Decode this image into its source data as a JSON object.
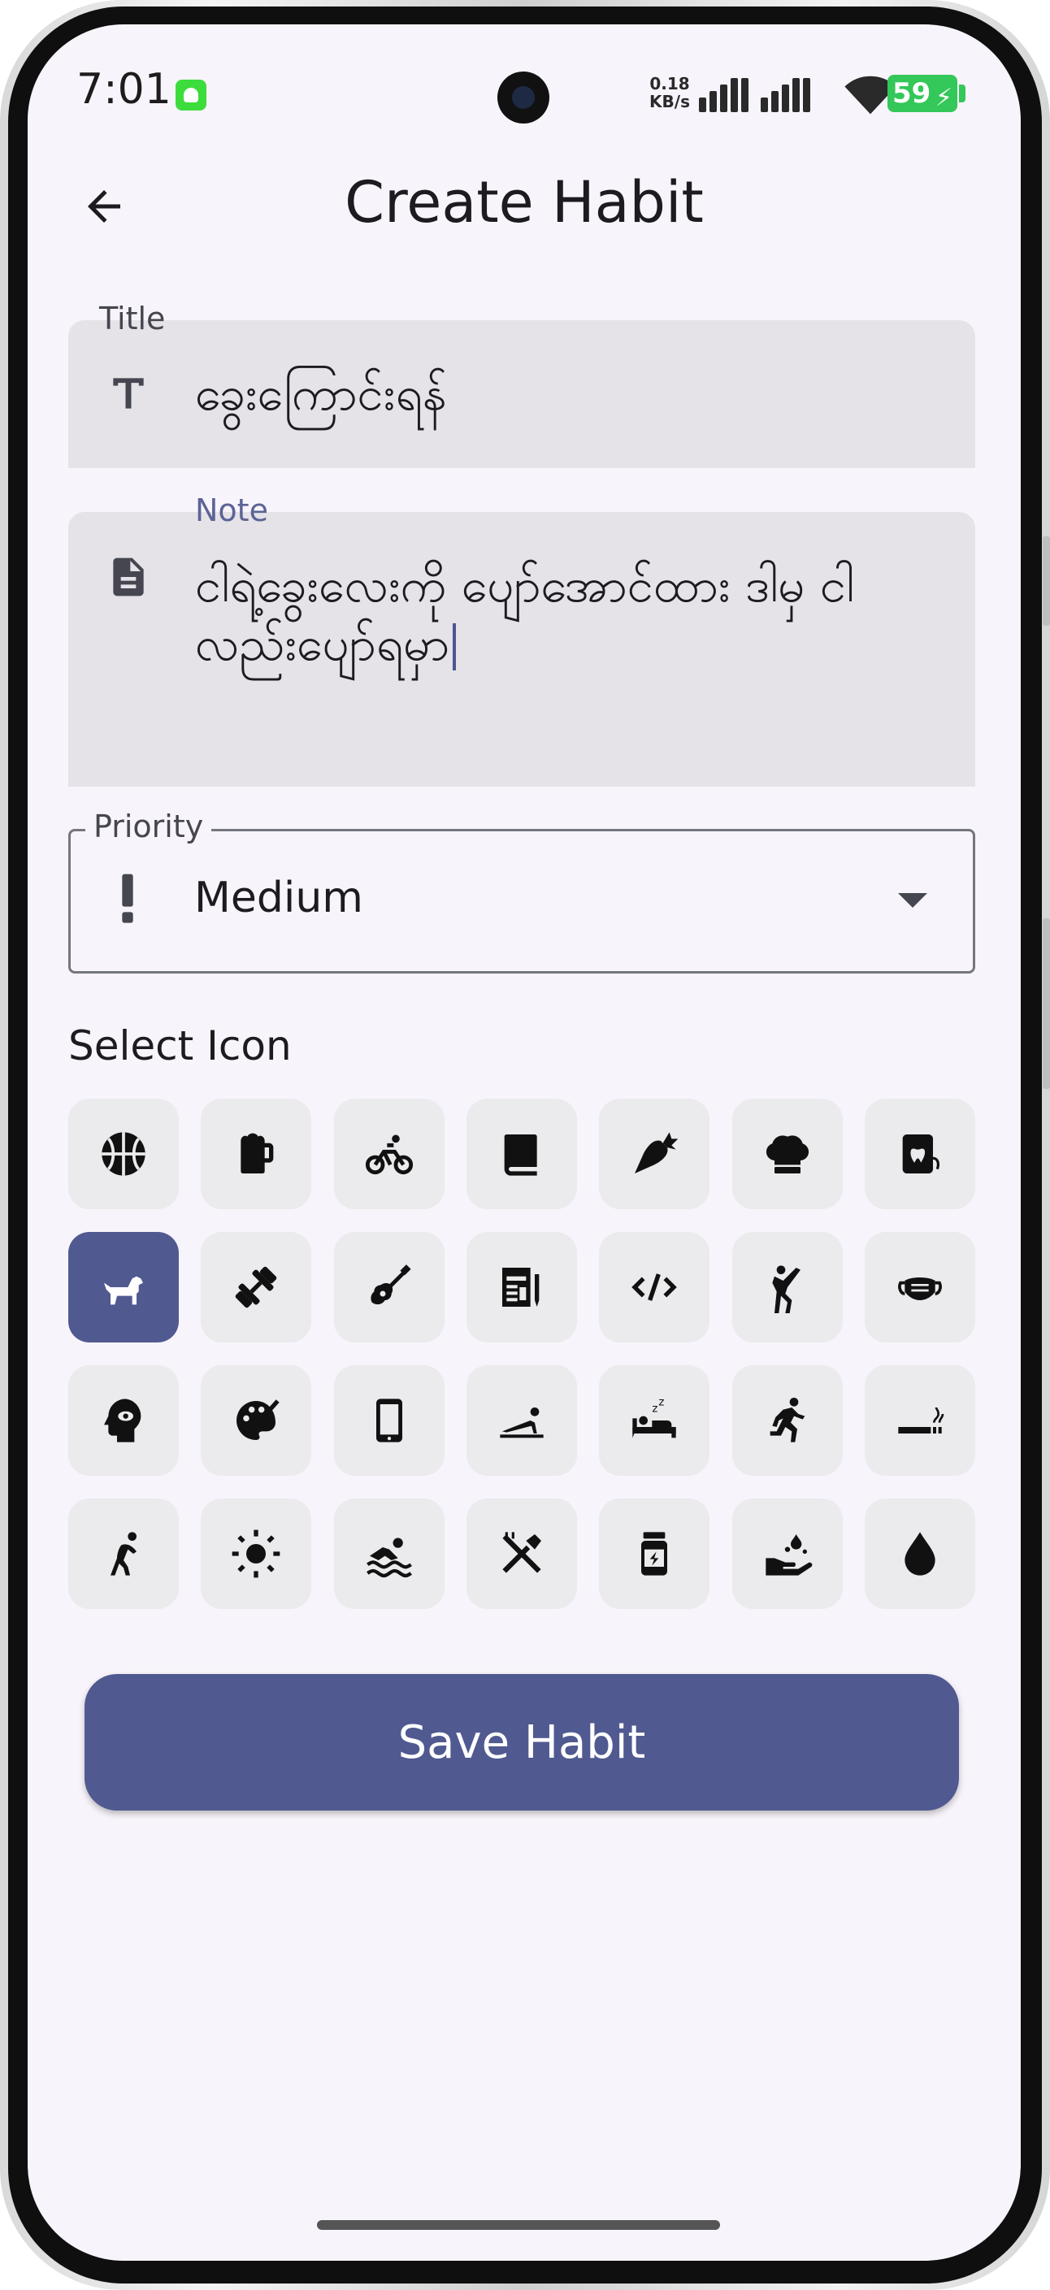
{
  "status_bar": {
    "time": "7:01",
    "net_speed_value": "0.18",
    "net_speed_unit": "KB/s",
    "battery": "59",
    "icons": [
      "android-icon",
      "signal-icon",
      "signal-icon",
      "wifi-icon",
      "battery-charging-icon"
    ]
  },
  "app_bar": {
    "title": "Create Habit",
    "back_icon": "arrow-back-icon"
  },
  "form": {
    "title_label": "Title",
    "title_value": "ခွေးကြောင်းရန်",
    "title_icon": "text-title-icon",
    "note_label": "Note",
    "note_value": "ငါရဲ့ခွေးလေးကို ပျော်အောင်ထား ဒါမှ ငါလည်းပျော်ရမှာ",
    "note_icon": "note-document-icon",
    "priority_label": "Priority",
    "priority_value": "Medium",
    "priority_icon": "exclamation-icon"
  },
  "icon_picker": {
    "label": "Select Icon",
    "selected": "dog-icon",
    "icons": [
      "basketball-icon",
      "beer-icon",
      "bicycle-icon",
      "book-icon",
      "carrot-icon",
      "chef-hat-icon",
      "dental-floss-icon",
      "dog-icon",
      "dumbbell-icon",
      "guitar-icon",
      "journal-icon",
      "code-icon",
      "karate-icon",
      "face-mask-icon",
      "mind-icon",
      "palette-icon",
      "smartphone-icon",
      "pushup-icon",
      "sleep-icon",
      "running-icon",
      "smoking-icon",
      "stretching-icon",
      "sun-icon",
      "swimming-icon",
      "brush-teeth-icon",
      "vitamin-bottle-icon",
      "watering-hand-icon",
      "water-drop-icon"
    ]
  },
  "actions": {
    "save_label": "Save Habit"
  },
  "colors": {
    "primary": "#505a90",
    "background": "#f8f4fb",
    "field_fill": "#e5e2e8",
    "tile_fill": "#ebeaec",
    "note_label": "#5c6396"
  }
}
